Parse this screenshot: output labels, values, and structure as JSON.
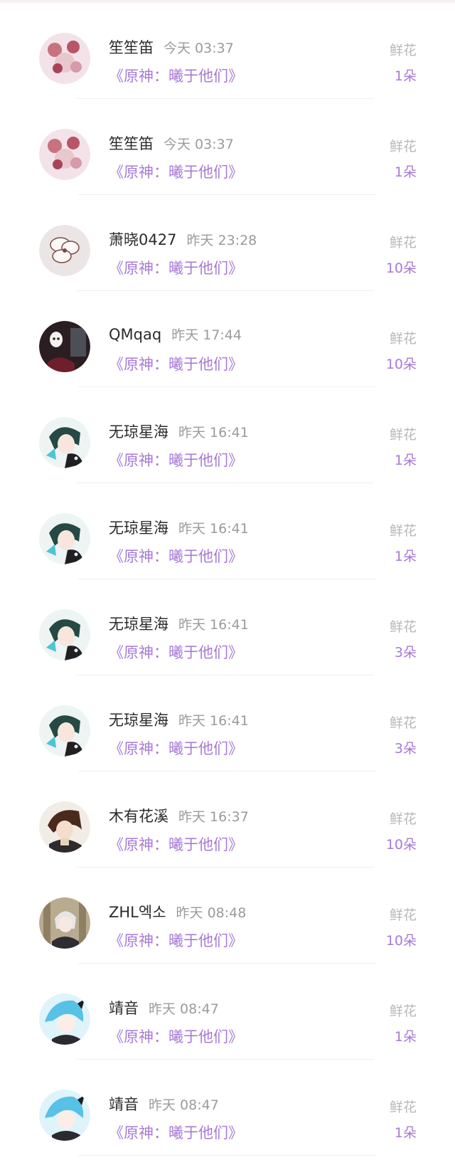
{
  "items": [
    {
      "name": "笙笙笛",
      "time": "今天 03:37",
      "work": "《原神：曦于他们》",
      "gift_label": "鲜花",
      "gift_count": "1朵",
      "avatar_icon": "avatar-pink-anime-icon"
    },
    {
      "name": "笙笙笛",
      "time": "今天 03:37",
      "work": "《原神：曦于他们》",
      "gift_label": "鲜花",
      "gift_count": "1朵",
      "avatar_icon": "avatar-pink-anime-icon"
    },
    {
      "name": "萧晓0427",
      "time": "昨天 23:28",
      "work": "《原神：曦于他们》",
      "gift_label": "鲜花",
      "gift_count": "10朵",
      "avatar_icon": "avatar-flower-icon"
    },
    {
      "name": "QMqaq",
      "time": "昨天 17:44",
      "work": "《原神：曦于他们》",
      "gift_label": "鲜花",
      "gift_count": "10朵",
      "avatar_icon": "avatar-mask-icon"
    },
    {
      "name": "无琼星海",
      "time": "昨天 16:41",
      "work": "《原神：曦于他们》",
      "gift_label": "鲜花",
      "gift_count": "1朵",
      "avatar_icon": "avatar-green-hair-anime-icon"
    },
    {
      "name": "无琼星海",
      "time": "昨天 16:41",
      "work": "《原神：曦于他们》",
      "gift_label": "鲜花",
      "gift_count": "1朵",
      "avatar_icon": "avatar-green-hair-anime-icon"
    },
    {
      "name": "无琼星海",
      "time": "昨天 16:41",
      "work": "《原神：曦于他们》",
      "gift_label": "鲜花",
      "gift_count": "3朵",
      "avatar_icon": "avatar-green-hair-anime-icon"
    },
    {
      "name": "无琼星海",
      "time": "昨天 16:41",
      "work": "《原神：曦于他们》",
      "gift_label": "鲜花",
      "gift_count": "3朵",
      "avatar_icon": "avatar-green-hair-anime-icon"
    },
    {
      "name": "木有花溪",
      "time": "昨天 16:37",
      "work": "《原神：曦于他们》",
      "gift_label": "鲜花",
      "gift_count": "10朵",
      "avatar_icon": "avatar-brown-hair-anime-icon"
    },
    {
      "name": "ZHL엑소",
      "time": "昨天 08:48",
      "work": "《原神：曦于他们》",
      "gift_label": "鲜花",
      "gift_count": "10朵",
      "avatar_icon": "avatar-silver-hair-anime-icon"
    },
    {
      "name": "靖音",
      "time": "昨天 08:47",
      "work": "《原神：曦于他们》",
      "gift_label": "鲜花",
      "gift_count": "1朵",
      "avatar_icon": "avatar-blue-hair-anime-icon"
    },
    {
      "name": "靖音",
      "time": "昨天 08:47",
      "work": "《原神：曦于他们》",
      "gift_label": "鲜花",
      "gift_count": "1朵",
      "avatar_icon": "avatar-blue-hair-anime-icon"
    }
  ],
  "colors": {
    "accent": "#a87ad6",
    "muted": "#9b9b9b",
    "text": "#2b2b2b"
  }
}
